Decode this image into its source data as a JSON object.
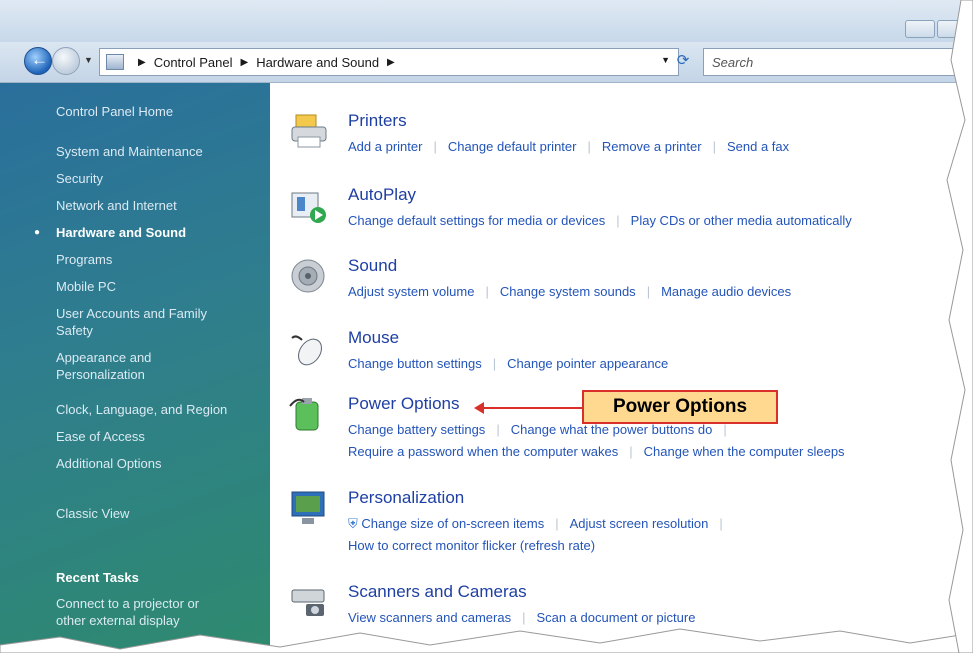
{
  "address_bar": {
    "path": [
      "Control Panel",
      "Hardware and Sound"
    ],
    "search_placeholder": "Search"
  },
  "sidebar": {
    "items": [
      {
        "label": "Control Panel Home"
      },
      {
        "label": "System and Maintenance"
      },
      {
        "label": "Security"
      },
      {
        "label": "Network and Internet"
      },
      {
        "label": "Hardware and Sound",
        "active": true
      },
      {
        "label": "Programs"
      },
      {
        "label": "Mobile PC"
      },
      {
        "label": "User Accounts and Family Safety"
      },
      {
        "label": "Appearance and Personalization"
      },
      {
        "label": "Clock, Language, and Region"
      },
      {
        "label": "Ease of Access"
      },
      {
        "label": "Additional Options"
      },
      {
        "label": "Classic View"
      }
    ],
    "recent_tasks_label": "Recent Tasks",
    "recent_tasks": [
      {
        "label": "Connect to a projector or other external display"
      }
    ]
  },
  "categories": [
    {
      "title": "Printers",
      "icon": "printer-icon",
      "links": [
        [
          "Add a printer",
          "Change default printer",
          "Remove a printer",
          "Send a fax"
        ]
      ]
    },
    {
      "title": "AutoPlay",
      "icon": "autoplay-icon",
      "links": [
        [
          "Change default settings for media or devices",
          "Play CDs or other media automatically"
        ]
      ]
    },
    {
      "title": "Sound",
      "icon": "speaker-icon",
      "links": [
        [
          "Adjust system volume",
          "Change system sounds",
          "Manage audio devices"
        ]
      ]
    },
    {
      "title": "Mouse",
      "icon": "mouse-icon",
      "links": [
        [
          "Change button settings",
          "Change pointer appearance"
        ]
      ]
    },
    {
      "title": "Power Options",
      "icon": "power-options-icon",
      "links": [
        [
          "Change battery settings",
          "Change what the power buttons do"
        ],
        [
          "Require a password when the computer wakes",
          "Change when the computer sleeps"
        ]
      ]
    },
    {
      "title": "Personalization",
      "icon": "personalization-icon",
      "links": [
        [
          "Change size of on-screen items",
          "Adjust screen resolution"
        ],
        [
          "How to correct monitor flicker (refresh rate)"
        ]
      ]
    },
    {
      "title": "Scanners and Cameras",
      "icon": "scanner-icon",
      "links": [
        [
          "View scanners and cameras",
          "Scan a document or picture"
        ]
      ]
    }
  ],
  "callout": {
    "label": "Power Options",
    "color": "#d9302a",
    "fill": "#ffd98f"
  }
}
